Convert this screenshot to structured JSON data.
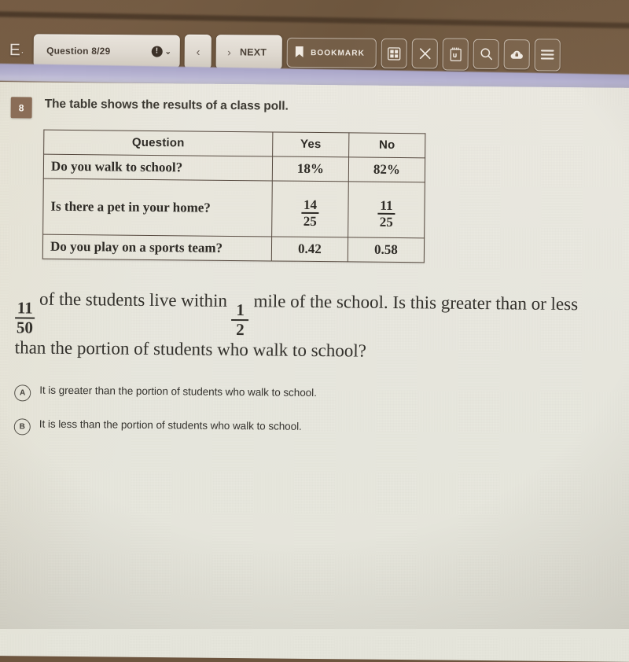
{
  "toolbar": {
    "brand": "E",
    "brand_dot": "·",
    "question_selector": {
      "label": "Question 8/29",
      "alert_glyph": "!",
      "chevron_glyph": "⌄"
    },
    "prev_label": "‹",
    "next": {
      "arrow": "›",
      "label": "NEXT"
    },
    "bookmark_label": "BOOKMARK",
    "icons": [
      "grid-icon",
      "close-icon",
      "notepad-icon",
      "search-icon",
      "cloud-lock-icon",
      "menu-icon"
    ]
  },
  "question": {
    "number": "8",
    "title": "The table shows the results of a class poll."
  },
  "table": {
    "headers": [
      "Question",
      "Yes",
      "No"
    ],
    "rows": [
      {
        "question": "Do you walk to school?",
        "yes": {
          "type": "plain",
          "text": "18%"
        },
        "no": {
          "type": "plain",
          "text": "82%"
        }
      },
      {
        "question": "Is there a pet in your home?",
        "yes": {
          "type": "fraction",
          "numerator": "14",
          "denominator": "25"
        },
        "no": {
          "type": "fraction",
          "numerator": "11",
          "denominator": "25"
        }
      },
      {
        "question": "Do you play on a sports team?",
        "yes": {
          "type": "plain",
          "text": "0.42"
        },
        "no": {
          "type": "plain",
          "text": "0.58"
        }
      }
    ]
  },
  "prompt": {
    "fraction_1": {
      "numerator": "11",
      "denominator": "50"
    },
    "text_1": " of the students live within ",
    "fraction_2": {
      "numerator": "1",
      "denominator": "2"
    },
    "text_2": " mile of the school. Is this greater than or less than the portion of students who walk to school?"
  },
  "choices": [
    {
      "letter": "A",
      "text": "It is greater than the portion of students who walk to school."
    },
    {
      "letter": "B",
      "text": "It is less than the portion of students who walk to school."
    }
  ],
  "colors": {
    "desk_brown": "#6e563f",
    "toolbar_pill": "#ded8cf",
    "badge_brown": "#8a6d57",
    "page_cream": "#e9e8df",
    "lavender_band": "#b9b6d3",
    "table_border": "#56493f"
  }
}
